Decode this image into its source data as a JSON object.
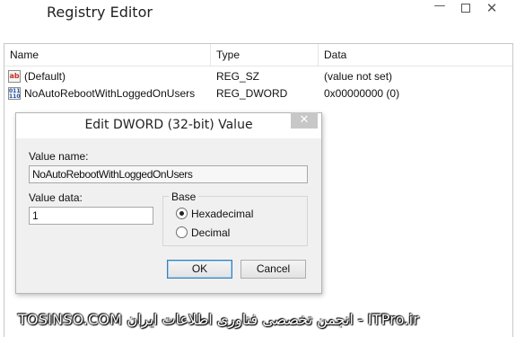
{
  "window": {
    "title": "Registry Editor",
    "controls": {
      "minimize": "—",
      "close": "✕"
    }
  },
  "columns": {
    "name": "Name",
    "type": "Type",
    "data": "Data"
  },
  "values": [
    {
      "icon": "string-value-icon",
      "icon_text": "ab",
      "name": "(Default)",
      "type": "REG_SZ",
      "data": "(value not set)"
    },
    {
      "icon": "binary-value-icon",
      "icon_text": "011 110",
      "name": "NoAutoRebootWithLoggedOnUsers",
      "type": "REG_DWORD",
      "data": "0x00000000 (0)"
    }
  ],
  "dialog": {
    "title": "Edit DWORD (32-bit) Value",
    "close_glyph": "✕",
    "value_name_label": "Value name:",
    "value_name": "NoAutoRebootWithLoggedOnUsers",
    "value_data_label": "Value data:",
    "value_data": "1",
    "base_label": "Base",
    "base_options": [
      {
        "label": "Hexadecimal",
        "selected": true
      },
      {
        "label": "Decimal",
        "selected": false
      }
    ],
    "ok_label": "OK",
    "cancel_label": "Cancel"
  },
  "watermark": "TOSINSO.COM انجمن تخصصی فناوری اطلاعات ایران - ITPro.ir",
  "colors": {
    "dialog_bg": "#f0f0f0",
    "close_button_bg": "#c7c7c7",
    "default_button_border": "#3c7fb1"
  }
}
